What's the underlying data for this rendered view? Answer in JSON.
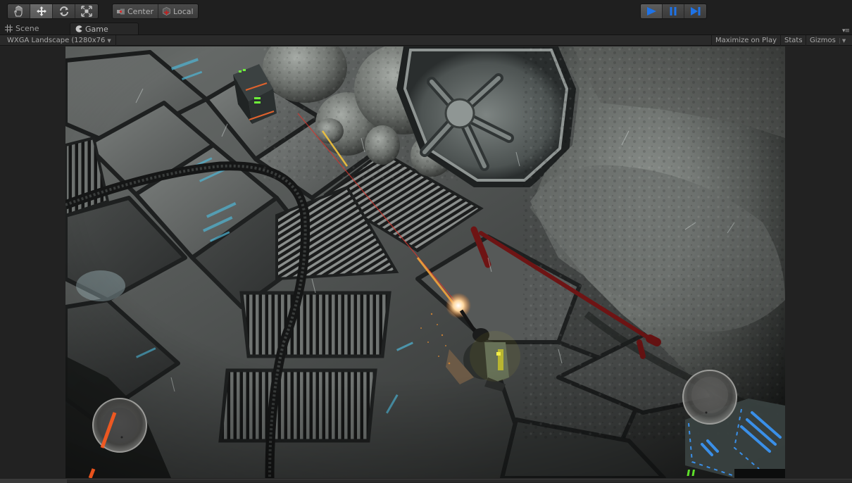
{
  "toolbar": {
    "tools": [
      {
        "name": "hand",
        "icon": "hand-icon",
        "active": false
      },
      {
        "name": "move",
        "icon": "move-icon",
        "active": true
      },
      {
        "name": "rotate",
        "icon": "rotate-icon",
        "active": false
      },
      {
        "name": "scale",
        "icon": "scale-icon",
        "active": false
      }
    ],
    "pivot_mode_label": "Center",
    "pivot_rotation_label": "Local",
    "play_controls": [
      {
        "name": "play",
        "icon": "play-icon",
        "active": true
      },
      {
        "name": "pause",
        "icon": "pause-icon",
        "active": false
      },
      {
        "name": "step",
        "icon": "step-icon",
        "active": false
      }
    ],
    "accent_color": "#1e73e8"
  },
  "tabs": [
    {
      "label": "Scene",
      "icon": "grid-icon",
      "active": false
    },
    {
      "label": "Game",
      "icon": "pacman-icon",
      "active": true
    }
  ],
  "game_view": {
    "resolution_label": "WXGA Landscape (1280x76",
    "maximize_on_play_label": "Maximize on Play",
    "stats_label": "Stats",
    "gizmos_label": "Gizmos"
  },
  "scene": {
    "description": "Top-down sci-fi shooter: armored soldier firing on metal floor panels near rocks and a large ventilation fan",
    "hud": {
      "left_joystick": "movement",
      "right_joystick": "aim-fire",
      "ammo_indicator_color": "#5ee02a"
    }
  }
}
